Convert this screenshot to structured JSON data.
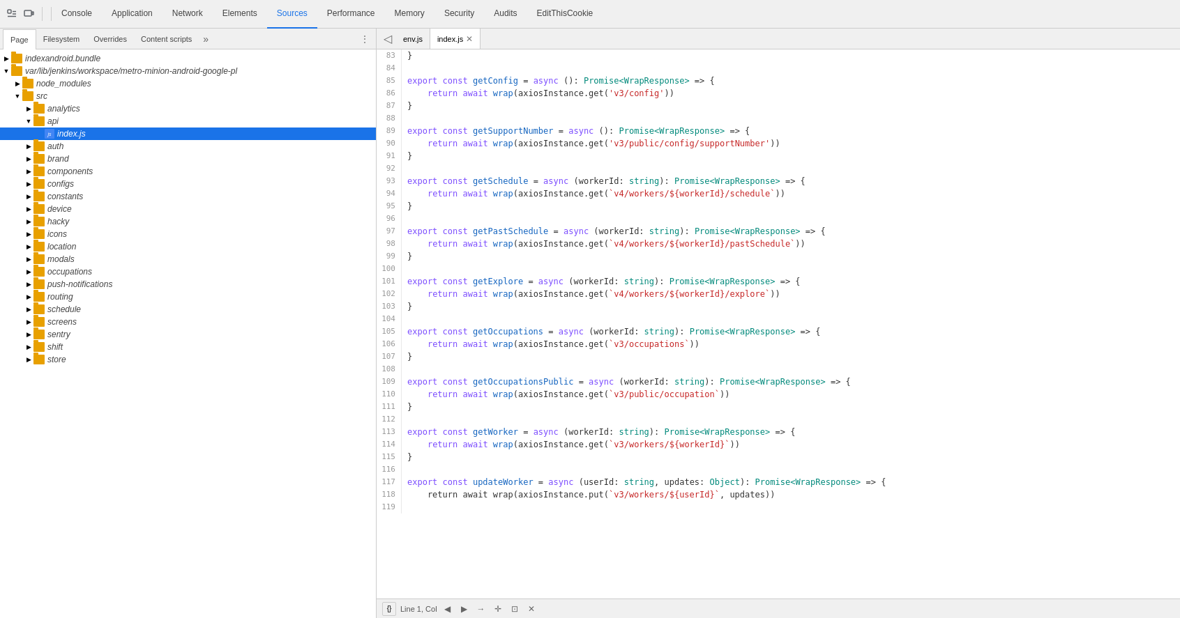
{
  "toolbar": {
    "icons": [
      {
        "name": "inspect-icon",
        "symbol": "⊡"
      },
      {
        "name": "device-icon",
        "symbol": "▭"
      }
    ],
    "tabs": [
      {
        "id": "console",
        "label": "Console",
        "active": false
      },
      {
        "id": "application",
        "label": "Application",
        "active": false
      },
      {
        "id": "network",
        "label": "Network",
        "active": false
      },
      {
        "id": "elements",
        "label": "Elements",
        "active": false
      },
      {
        "id": "sources",
        "label": "Sources",
        "active": true
      },
      {
        "id": "performance",
        "label": "Performance",
        "active": false
      },
      {
        "id": "memory",
        "label": "Memory",
        "active": false
      },
      {
        "id": "security",
        "label": "Security",
        "active": false
      },
      {
        "id": "audits",
        "label": "Audits",
        "active": false
      },
      {
        "id": "editthiscookie",
        "label": "EditThisCookie",
        "active": false
      }
    ]
  },
  "subtabs": [
    {
      "label": "Page",
      "active": true
    },
    {
      "label": "Filesystem",
      "active": false
    },
    {
      "label": "Overrides",
      "active": false
    },
    {
      "label": "Content scripts",
      "active": false
    }
  ],
  "file_tree": [
    {
      "id": "f1",
      "label": "indexandroid.bundle",
      "type": "folder",
      "collapsed": true,
      "level": 0
    },
    {
      "id": "f2",
      "label": "var/lib/jenkins/workspace/metro-minion-android-google-pl",
      "type": "folder",
      "collapsed": false,
      "level": 0
    },
    {
      "id": "f3",
      "label": "node_modules",
      "type": "folder",
      "collapsed": true,
      "level": 1
    },
    {
      "id": "f4",
      "label": "src",
      "type": "folder",
      "collapsed": false,
      "level": 1
    },
    {
      "id": "f5",
      "label": "analytics",
      "type": "folder",
      "collapsed": true,
      "level": 2
    },
    {
      "id": "f6",
      "label": "api",
      "type": "folder",
      "collapsed": false,
      "level": 2
    },
    {
      "id": "f7",
      "label": "index.js",
      "type": "file",
      "selected": true,
      "level": 3
    },
    {
      "id": "f8",
      "label": "auth",
      "type": "folder",
      "collapsed": true,
      "level": 2
    },
    {
      "id": "f9",
      "label": "brand",
      "type": "folder",
      "collapsed": true,
      "level": 2
    },
    {
      "id": "f10",
      "label": "components",
      "type": "folder",
      "collapsed": true,
      "level": 2
    },
    {
      "id": "f11",
      "label": "configs",
      "type": "folder",
      "collapsed": true,
      "level": 2
    },
    {
      "id": "f12",
      "label": "constants",
      "type": "folder",
      "collapsed": true,
      "level": 2
    },
    {
      "id": "f13",
      "label": "device",
      "type": "folder",
      "collapsed": true,
      "level": 2
    },
    {
      "id": "f14",
      "label": "hacky",
      "type": "folder",
      "collapsed": true,
      "level": 2
    },
    {
      "id": "f15",
      "label": "icons",
      "type": "folder",
      "collapsed": true,
      "level": 2
    },
    {
      "id": "f16",
      "label": "location",
      "type": "folder",
      "collapsed": true,
      "level": 2
    },
    {
      "id": "f17",
      "label": "modals",
      "type": "folder",
      "collapsed": true,
      "level": 2
    },
    {
      "id": "f18",
      "label": "occupations",
      "type": "folder",
      "collapsed": true,
      "level": 2
    },
    {
      "id": "f19",
      "label": "push-notifications",
      "type": "folder",
      "collapsed": true,
      "level": 2
    },
    {
      "id": "f20",
      "label": "routing",
      "type": "folder",
      "collapsed": true,
      "level": 2
    },
    {
      "id": "f21",
      "label": "schedule",
      "type": "folder",
      "collapsed": true,
      "level": 2
    },
    {
      "id": "f22",
      "label": "screens",
      "type": "folder",
      "collapsed": true,
      "level": 2
    },
    {
      "id": "f23",
      "label": "sentry",
      "type": "folder",
      "collapsed": true,
      "level": 2
    },
    {
      "id": "f24",
      "label": "shift",
      "type": "folder",
      "collapsed": true,
      "level": 2
    },
    {
      "id": "f25",
      "label": "store",
      "type": "folder",
      "collapsed": true,
      "level": 2
    }
  ],
  "editor_tabs": [
    {
      "label": "env.js",
      "active": false,
      "closeable": false
    },
    {
      "label": "index.js",
      "active": true,
      "closeable": true
    }
  ],
  "code_lines": [
    {
      "num": 83,
      "content": "}"
    },
    {
      "num": 84,
      "content": ""
    },
    {
      "num": 85,
      "content": "export const getConfig = async (): Promise<WrapResponse> => {"
    },
    {
      "num": 86,
      "content": "    return await wrap(axiosInstance.get('v3/config'))"
    },
    {
      "num": 87,
      "content": "}"
    },
    {
      "num": 88,
      "content": ""
    },
    {
      "num": 89,
      "content": "export const getSupportNumber = async (): Promise<WrapResponse> => {"
    },
    {
      "num": 90,
      "content": "    return await wrap(axiosInstance.get('v3/public/config/supportNumber'))"
    },
    {
      "num": 91,
      "content": "}"
    },
    {
      "num": 92,
      "content": ""
    },
    {
      "num": 93,
      "content": "export const getSchedule = async (workerId: string): Promise<WrapResponse> => {"
    },
    {
      "num": 94,
      "content": "    return await wrap(axiosInstance.get(`v4/workers/${workerId}/schedule`))"
    },
    {
      "num": 95,
      "content": "}"
    },
    {
      "num": 96,
      "content": ""
    },
    {
      "num": 97,
      "content": "export const getPastSchedule = async (workerId: string): Promise<WrapResponse> => {"
    },
    {
      "num": 98,
      "content": "    return await wrap(axiosInstance.get(`v4/workers/${workerId}/pastSchedule`))"
    },
    {
      "num": 99,
      "content": "}"
    },
    {
      "num": 100,
      "content": ""
    },
    {
      "num": 101,
      "content": "export const getExplore = async (workerId: string): Promise<WrapResponse> => {"
    },
    {
      "num": 102,
      "content": "    return await wrap(axiosInstance.get(`v4/workers/${workerId}/explore`))"
    },
    {
      "num": 103,
      "content": "}"
    },
    {
      "num": 104,
      "content": ""
    },
    {
      "num": 105,
      "content": "export const getOccupations = async (workerId: string): Promise<WrapResponse> => {"
    },
    {
      "num": 106,
      "content": "    return await wrap(axiosInstance.get(`v3/occupations`))"
    },
    {
      "num": 107,
      "content": "}"
    },
    {
      "num": 108,
      "content": ""
    },
    {
      "num": 109,
      "content": "export const getOccupationsPublic = async (workerId: string): Promise<WrapResponse> => {"
    },
    {
      "num": 110,
      "content": "    return await wrap(axiosInstance.get(`v3/public/occupation`))"
    },
    {
      "num": 111,
      "content": "}"
    },
    {
      "num": 112,
      "content": ""
    },
    {
      "num": 113,
      "content": "export const getWorker = async (workerId: string): Promise<WrapResponse> => {"
    },
    {
      "num": 114,
      "content": "    return await wrap(axiosInstance.get(`v3/workers/${workerId}`))"
    },
    {
      "num": 115,
      "content": "}"
    },
    {
      "num": 116,
      "content": ""
    },
    {
      "num": 117,
      "content": "export const updateWorker = async (userId: string, updates: Object): Promise<WrapResponse> => {"
    },
    {
      "num": 118,
      "content": "    return await wrap(axiosInstance.put(`v3/workers/${userId}`, updates))"
    },
    {
      "num": 119,
      "content": ""
    }
  ],
  "status_bar": {
    "position": "Line 1, Col",
    "nav_icons": [
      "◀",
      "▶",
      "→",
      "✛",
      "⊡",
      "✕"
    ]
  }
}
